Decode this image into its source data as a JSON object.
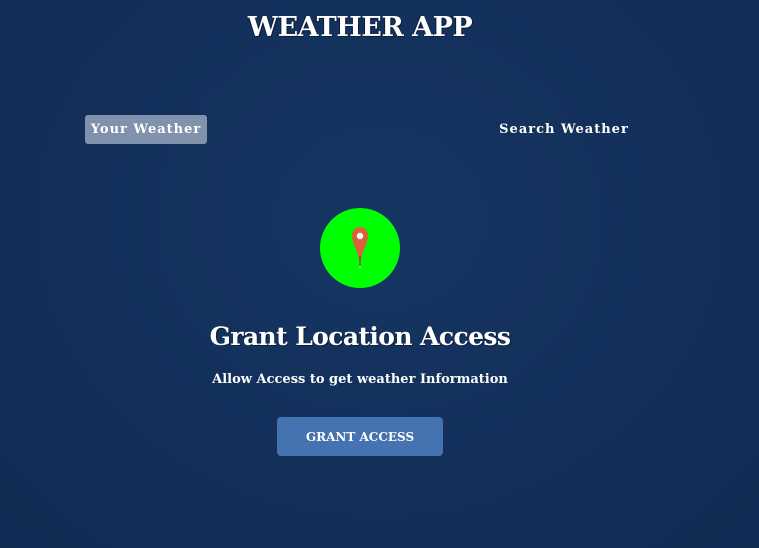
{
  "header": {
    "title": "WEATHER APP"
  },
  "tabs": [
    {
      "label": "Your Weather",
      "active": true
    },
    {
      "label": "Search Weather",
      "active": false
    }
  ],
  "grant_location": {
    "icon": "map-pin-icon",
    "icon_badge_color": "#00ff00",
    "pin_color": "#d9623a",
    "title": "Grant Location Access",
    "subtitle": "Allow Access to get weather Information",
    "button_label": "GRANT ACCESS"
  },
  "colors": {
    "background": "#132f56",
    "active_tab": "#a9b5cc",
    "button": "#4573b2"
  }
}
